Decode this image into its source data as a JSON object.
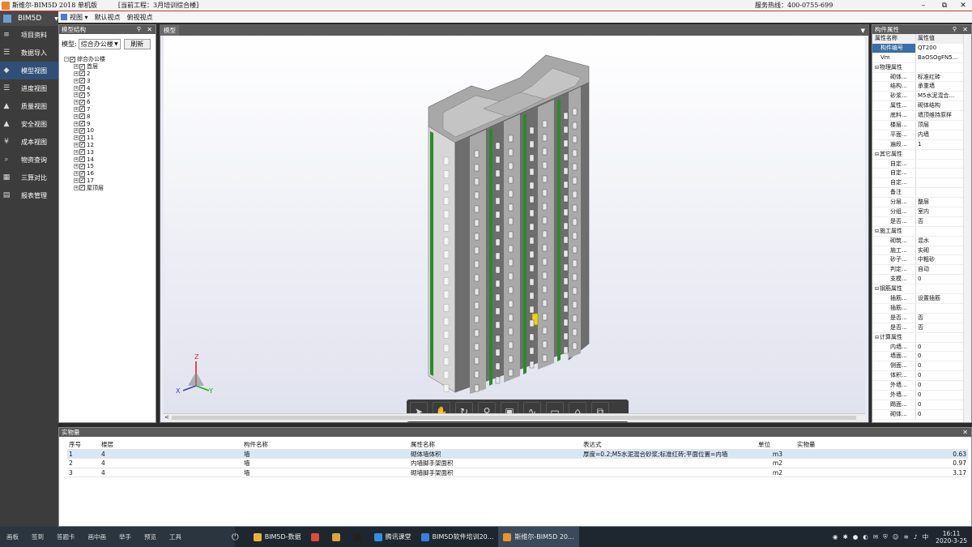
{
  "titlebar": {
    "app_name": "斯维尔-BIM5D 2018  单机版",
    "project": "[当前工程：3月培训综合楼]",
    "hotline": "服务热线：400-0755-699",
    "min": "–",
    "restore": "⧉",
    "close": "✕"
  },
  "leftnav": {
    "header": "BIM5D",
    "items": [
      {
        "label": "项目资料",
        "icon": "≡"
      },
      {
        "label": "数据导入",
        "icon": "☰"
      },
      {
        "label": "模型视图",
        "icon": "◆"
      },
      {
        "label": "进度视图",
        "icon": "☰"
      },
      {
        "label": "质量视图",
        "icon": "▲"
      },
      {
        "label": "安全视图",
        "icon": "▲"
      },
      {
        "label": "成本视图",
        "icon": "¥"
      },
      {
        "label": "物资查询",
        "icon": "⌕"
      },
      {
        "label": "三算对比",
        "icon": "▦"
      },
      {
        "label": "报表管理",
        "icon": "▤"
      }
    ]
  },
  "toolbar": {
    "view": "视图 ▾",
    "default_view": "默认视点",
    "top_view": "俯视视点"
  },
  "tree_panel": {
    "title": "模型结构",
    "model_label": "模型:",
    "model_value": "综合办公楼",
    "refresh": "刷新",
    "root": "综合办公楼",
    "floors": [
      "首层",
      "2",
      "3",
      "4",
      "5",
      "6",
      "7",
      "8",
      "9",
      "10",
      "11",
      "12",
      "13",
      "14",
      "15",
      "16",
      "17",
      "屋顶层"
    ]
  },
  "viewport": {
    "tab": "模型",
    "axes": {
      "z": "Z",
      "x": "X",
      "y": "Y"
    }
  },
  "props_panel": {
    "title": "构件属性",
    "col_name": "属性名称",
    "col_value": "属性值",
    "rows": [
      {
        "n": "构件编号",
        "v": "QT200",
        "sel": true
      },
      {
        "n": "Vm",
        "v": "BaOSOgFN5..."
      },
      {
        "n": "物理属性",
        "v": "",
        "grp": true
      },
      {
        "n": "砌体...",
        "v": "标准红砖"
      },
      {
        "n": "结构...",
        "v": "承重墙"
      },
      {
        "n": "砂浆...",
        "v": "M5水泥混合..."
      },
      {
        "n": "属性...",
        "v": "砌体结构"
      },
      {
        "n": "底料...",
        "v": "墙顶维持原样"
      },
      {
        "n": "楼层...",
        "v": "顶层"
      },
      {
        "n": "平面...",
        "v": "内墙"
      },
      {
        "n": "遍段...",
        "v": "1"
      },
      {
        "n": "其它属性",
        "v": "",
        "grp": true
      },
      {
        "n": "自定...",
        "v": ""
      },
      {
        "n": "自定...",
        "v": ""
      },
      {
        "n": "自定...",
        "v": ""
      },
      {
        "n": "备注",
        "v": ""
      },
      {
        "n": "分层...",
        "v": "整层"
      },
      {
        "n": "分组...",
        "v": "室内"
      },
      {
        "n": "是否...",
        "v": "否"
      },
      {
        "n": "施工属性",
        "v": "",
        "grp": true
      },
      {
        "n": "砌筑...",
        "v": "混水"
      },
      {
        "n": "施工...",
        "v": "实砌"
      },
      {
        "n": "砂子...",
        "v": "中粗砂"
      },
      {
        "n": "判定...",
        "v": "自动"
      },
      {
        "n": "支模...",
        "v": "0"
      },
      {
        "n": "钢筋属性",
        "v": "",
        "grp": true
      },
      {
        "n": "插筋...",
        "v": "设置插筋"
      },
      {
        "n": "插筋...",
        "v": ""
      },
      {
        "n": "是否...",
        "v": "否"
      },
      {
        "n": "是否...",
        "v": "否"
      },
      {
        "n": "计算属性",
        "v": "",
        "grp": true
      },
      {
        "n": "内墙...",
        "v": "0"
      },
      {
        "n": "墙面...",
        "v": "0"
      },
      {
        "n": "侧面...",
        "v": "0"
      },
      {
        "n": "体积...",
        "v": "0"
      },
      {
        "n": "外墙...",
        "v": "0"
      },
      {
        "n": "外墙...",
        "v": "0"
      },
      {
        "n": "踢面...",
        "v": "0"
      },
      {
        "n": "砌体...",
        "v": "0"
      }
    ]
  },
  "bottom_panel": {
    "title": "实物量",
    "headers": [
      "序号",
      "楼层",
      "构件名称",
      "属性名称",
      "表达式",
      "单位",
      "实物量"
    ],
    "rows": [
      [
        "1",
        "4",
        "墙",
        "砌体墙体积",
        "厚度=0.2;M5水泥混合砂浆;标准红砖;平面位置=内墙",
        "m3",
        "0.63"
      ],
      [
        "2",
        "4",
        "墙",
        "内墙脚手架面积",
        "",
        "m2",
        "0.97"
      ],
      [
        "3",
        "4",
        "墙",
        "砌墙脚手架面积",
        "",
        "m2",
        "3.17"
      ]
    ]
  },
  "taskbar": {
    "left_items": [
      "画板",
      "签到",
      "答题卡",
      "画中画",
      "举手",
      "预览",
      "工具"
    ],
    "apps": [
      {
        "label": "BIM5D-数据",
        "color": "#e8b23a"
      },
      {
        "label": "",
        "color": "#e04b3a"
      },
      {
        "label": "",
        "color": "#e0a23a"
      },
      {
        "label": "",
        "color": "#222222"
      },
      {
        "label": "腾讯课堂",
        "color": "#2f8fe0"
      },
      {
        "label": "BIM5D软件培训20...",
        "color": "#3a7fe0"
      },
      {
        "label": "斯维尔-BIM5D 20...",
        "color": "#e8942a"
      }
    ],
    "ime": "中",
    "time": "16:11",
    "date": "2020-3-25"
  }
}
